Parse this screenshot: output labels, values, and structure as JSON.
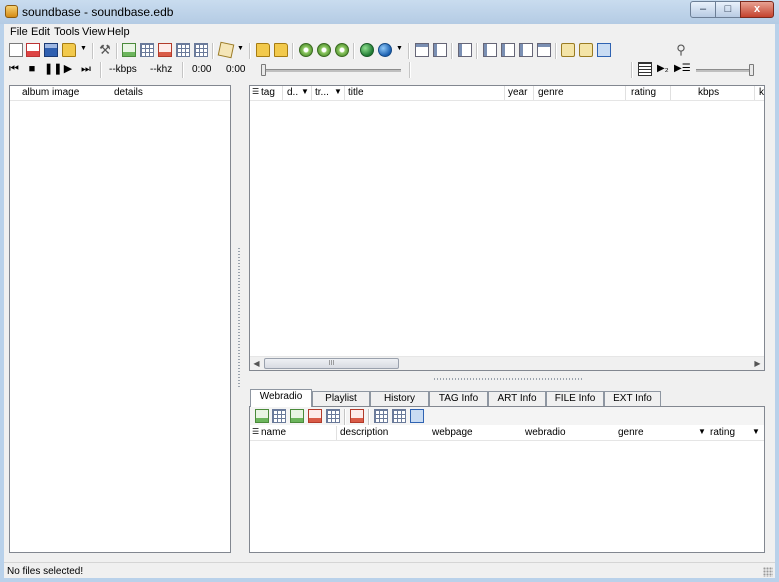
{
  "window": {
    "title": "soundbase - soundbase.edb"
  },
  "caption_buttons": {
    "minimize": "–",
    "maximize": "□",
    "close": "x"
  },
  "menu": [
    "File",
    "Edit",
    "Tools",
    "View",
    "Help"
  ],
  "player": {
    "bitrate": "--kbps",
    "samplerate": "--khz",
    "elapsed": "0:00",
    "total": "0:00",
    "seek_position": 0,
    "volume": 1
  },
  "left_panel": {
    "columns": [
      "album image",
      "details"
    ]
  },
  "tracks": {
    "columns": [
      {
        "label": "tag",
        "sort": false
      },
      {
        "label": "d..",
        "sort": true
      },
      {
        "label": "tr...",
        "sort": true
      },
      {
        "label": "title",
        "sort": false
      },
      {
        "label": "year",
        "sort": false
      },
      {
        "label": "genre",
        "sort": false
      },
      {
        "label": "rating",
        "sort": false
      },
      {
        "label": "kbps",
        "sort": false
      },
      {
        "label": "k",
        "sort": false
      }
    ],
    "scroll_thumb_glyph": "III"
  },
  "tabs": [
    {
      "label": "Webradio",
      "active": true
    },
    {
      "label": "Playlist",
      "active": false
    },
    {
      "label": "History",
      "active": false
    },
    {
      "label": "TAG Info",
      "active": false
    },
    {
      "label": "ART Info",
      "active": false
    },
    {
      "label": "FILE Info",
      "active": false
    },
    {
      "label": "EXT Info",
      "active": false
    }
  ],
  "webradio": {
    "columns": [
      "name",
      "description",
      "webpage",
      "webradio",
      "genre",
      "rating"
    ]
  },
  "status": {
    "text": "No files selected!"
  },
  "colors": {
    "title_bar": "#b9d1ea",
    "close_button": "#c4422d",
    "panel_border": "#828790",
    "chrome": "#f0f0f0"
  },
  "icons": [
    "new-database-icon",
    "new-red-icon",
    "save-icon",
    "open-folder-icon",
    "tools-icon",
    "add-files-icon",
    "export-icon",
    "remove-icon",
    "grid-icon",
    "edit-tag-icon",
    "folder-icon",
    "open-folder-icon",
    "cd-icon",
    "globe-icon",
    "layout-icon",
    "search-icon",
    "previous-icon",
    "stop-icon",
    "pause-icon",
    "play-icon",
    "next-icon",
    "playlist-icon",
    "play-next-icon",
    "options-icon"
  ]
}
